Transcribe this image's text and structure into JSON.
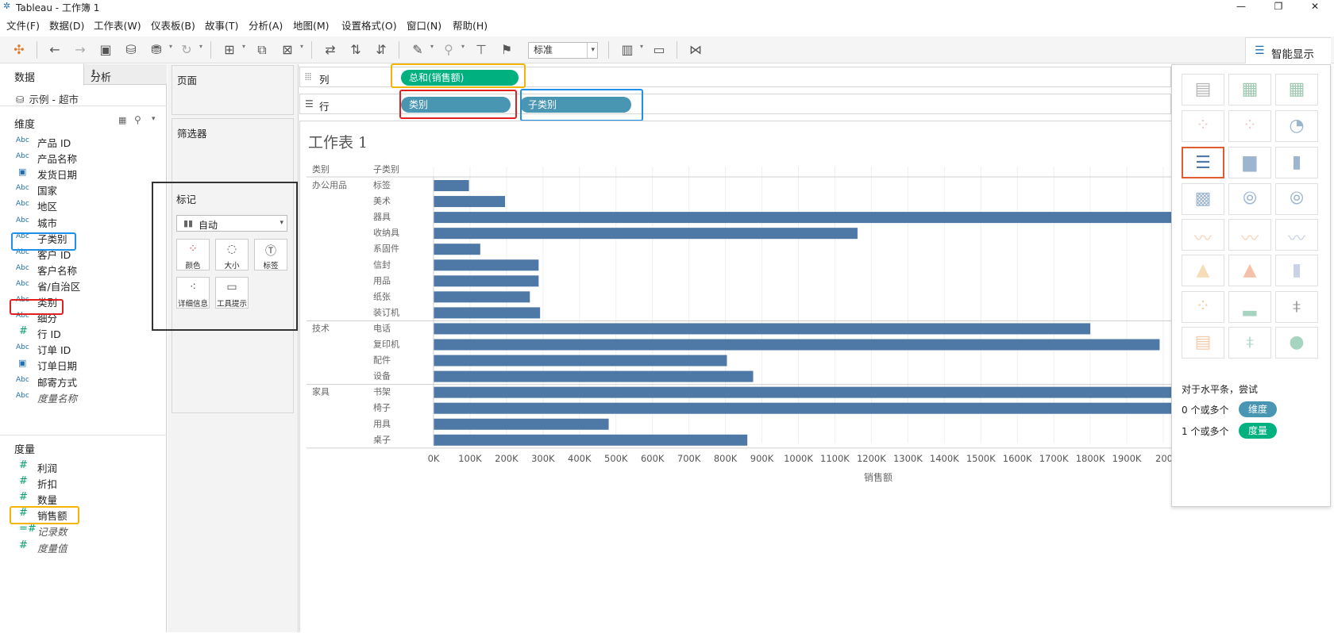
{
  "window": {
    "title": "Tableau - 工作簿 1",
    "minimize": "—",
    "restore": "❐",
    "close": "✕"
  },
  "menu": [
    "文件(F)",
    "数据(D)",
    "工作表(W)",
    "仪表板(B)",
    "故事(T)",
    "分析(A)",
    "地图(M)",
    "设置格式(O)",
    "窗口(N)",
    "帮助(H)"
  ],
  "toolbar": {
    "fit_select": "标准",
    "showme_label": "智能显示"
  },
  "data_pane": {
    "tab_data": "数据",
    "tab_analysis": "分析",
    "datasource": "示例 - 超市",
    "dimensions_header": "维度",
    "dimensions": [
      {
        "type": "Abc",
        "name": "产品 ID"
      },
      {
        "type": "Abc",
        "name": "产品名称"
      },
      {
        "type": "date",
        "name": "发货日期"
      },
      {
        "type": "Abc",
        "name": "国家"
      },
      {
        "type": "Abc",
        "name": "地区"
      },
      {
        "type": "Abc",
        "name": "城市"
      },
      {
        "type": "Abc",
        "name": "子类别"
      },
      {
        "type": "Abc",
        "name": "客户 ID"
      },
      {
        "type": "Abc",
        "name": "客户名称"
      },
      {
        "type": "Abc",
        "name": "省/自治区"
      },
      {
        "type": "Abc",
        "name": "类别"
      },
      {
        "type": "Abc",
        "name": "细分"
      },
      {
        "type": "#",
        "name": "行 ID"
      },
      {
        "type": "Abc",
        "name": "订单 ID"
      },
      {
        "type": "date",
        "name": "订单日期"
      },
      {
        "type": "Abc",
        "name": "邮寄方式"
      },
      {
        "type": "Abc",
        "name": "度量名称",
        "italic": true
      }
    ],
    "measures_header": "度量",
    "measures": [
      {
        "type": "#",
        "name": "利润"
      },
      {
        "type": "#",
        "name": "折扣"
      },
      {
        "type": "#",
        "name": "数量"
      },
      {
        "type": "#",
        "name": "销售额"
      },
      {
        "type": "=#",
        "name": "记录数",
        "italic": true
      },
      {
        "type": "#",
        "name": "度量值",
        "italic": true
      }
    ]
  },
  "cards": {
    "pages": "页面",
    "filters": "筛选器",
    "marks": "标记",
    "marks_type": "自动",
    "mark_buttons": [
      "颜色",
      "大小",
      "标签",
      "详细信息",
      "工具提示"
    ]
  },
  "shelves": {
    "columns_label": "列",
    "rows_label": "行",
    "columns_pills": [
      "总和(销售额)"
    ],
    "rows_pills": [
      "类别",
      "子类别"
    ]
  },
  "sheet": {
    "title": "工作表 1"
  },
  "colors": {
    "bar": "#4e79a7",
    "measure_pill": "#00b180",
    "dimension_pill": "#4996b2",
    "highlight_red": "#e02020",
    "highlight_blue": "#1e90e8",
    "highlight_orange": "#f5b400",
    "highlight_black": "#333333"
  },
  "chart_data": {
    "type": "bar",
    "orientation": "horizontal",
    "header_category": "类别",
    "header_subcategory": "子类别",
    "xlabel": "销售额",
    "groups": [
      {
        "category": "办公用品",
        "items": [
          {
            "name": "标签",
            "value": 97000
          },
          {
            "name": "美术",
            "value": 196000
          },
          {
            "name": "器具",
            "value": 2600000
          },
          {
            "name": "收纳具",
            "value": 1162000
          },
          {
            "name": "系固件",
            "value": 128000
          },
          {
            "name": "信封",
            "value": 288000
          },
          {
            "name": "用品",
            "value": 288000
          },
          {
            "name": "纸张",
            "value": 264000
          },
          {
            "name": "装订机",
            "value": 292000
          }
        ]
      },
      {
        "category": "技术",
        "items": [
          {
            "name": "电话",
            "value": 1800000
          },
          {
            "name": "复印机",
            "value": 1990000
          },
          {
            "name": "配件",
            "value": 804000
          },
          {
            "name": "设备",
            "value": 876000
          }
        ]
      },
      {
        "category": "家具",
        "items": [
          {
            "name": "书架",
            "value": 2700000
          },
          {
            "name": "椅子",
            "value": 2900000
          },
          {
            "name": "用具",
            "value": 480000
          },
          {
            "name": "桌子",
            "value": 860000
          }
        ]
      }
    ],
    "ticks": [
      "0K",
      "100K",
      "200K",
      "300K",
      "400K",
      "500K",
      "600K",
      "700K",
      "800K",
      "900K",
      "1000K",
      "1100K",
      "1200K",
      "1300K",
      "1400K",
      "1500K",
      "1600K",
      "1700K",
      "1800K",
      "1900K",
      "200"
    ]
  },
  "showme": {
    "hint": "对于水平条，尝试",
    "dim_line": "0 个或多个",
    "dim_pill": "维度",
    "mea_line": "1 个或多个",
    "mea_pill": "度量"
  }
}
